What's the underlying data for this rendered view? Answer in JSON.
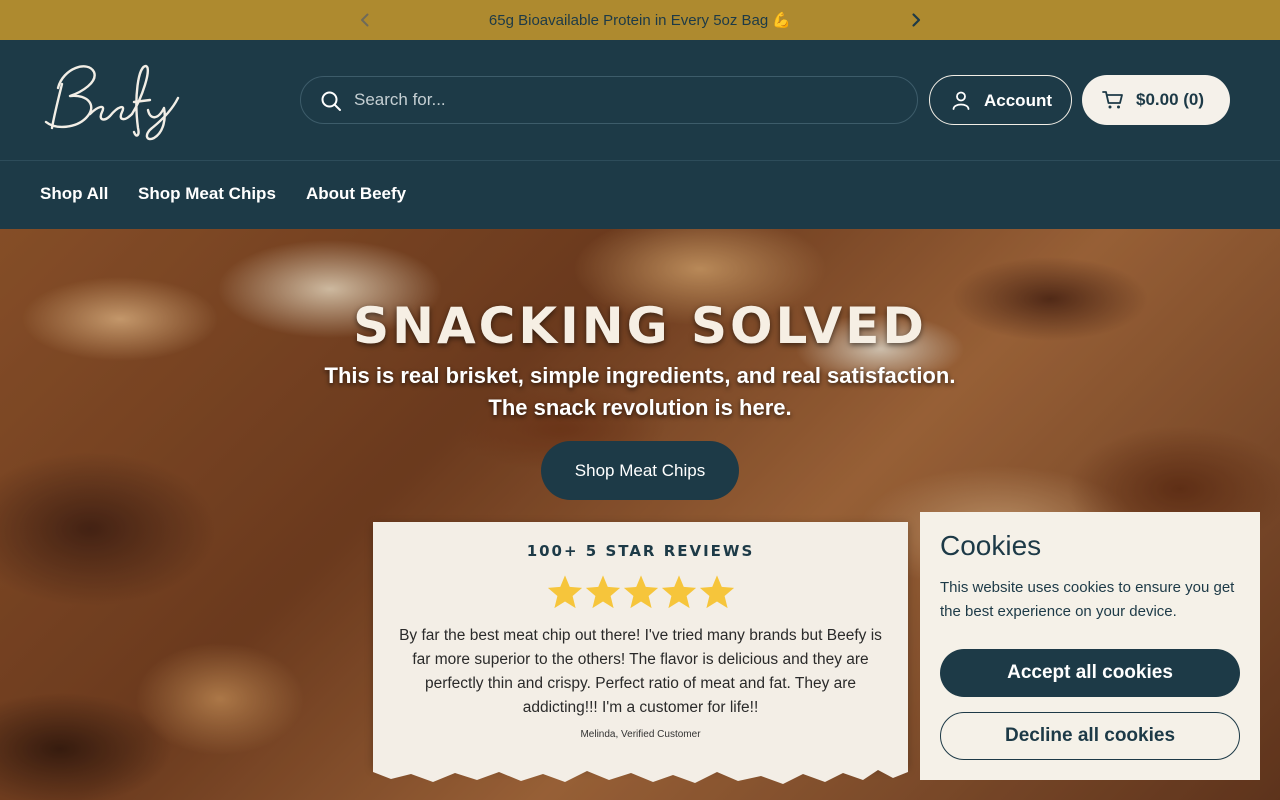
{
  "announcement": {
    "message": "65g Bioavailable Protein in Every 5oz Bag 💪",
    "prev_icon": "chevron-left-icon",
    "next_icon": "chevron-right-icon"
  },
  "header": {
    "logo_text": "Beefy",
    "search": {
      "placeholder": "Search for...",
      "value": "",
      "icon": "search-icon"
    },
    "account": {
      "label": "Account",
      "icon": "user-icon"
    },
    "cart": {
      "label": "$0.00 (0)",
      "icon": "cart-icon"
    }
  },
  "nav": {
    "items": [
      {
        "label": "Shop All"
      },
      {
        "label": "Shop Meat Chips"
      },
      {
        "label": "About Beefy"
      }
    ]
  },
  "hero": {
    "title": "SNACKING SOLVED",
    "subtitle_line1": "This is real brisket, simple ingredients, and real satisfaction.",
    "subtitle_line2": "The snack revolution is here.",
    "cta_label": "Shop Meat Chips"
  },
  "review": {
    "heading": "100+ 5 STAR REVIEWS",
    "rating": 5,
    "rating_max": 5,
    "text": "By far the best meat chip out there! I've tried many brands but Beefy is far more superior to the others! The flavor is delicious and they are perfectly thin and crispy. Perfect ratio of meat and fat. They are addicting!!! I'm a customer for life!!",
    "author": "Melinda, Verified Customer"
  },
  "cookies": {
    "title": "Cookies",
    "text": "This website uses cookies to ensure you get the best experience on your device.",
    "accept_label": "Accept all cookies",
    "decline_label": "Decline all cookies"
  },
  "colors": {
    "announcement_bg": "#ae8a2f",
    "header_bg": "#1d3a47",
    "cream": "#f5f1e8",
    "star": "#f6c53b"
  }
}
